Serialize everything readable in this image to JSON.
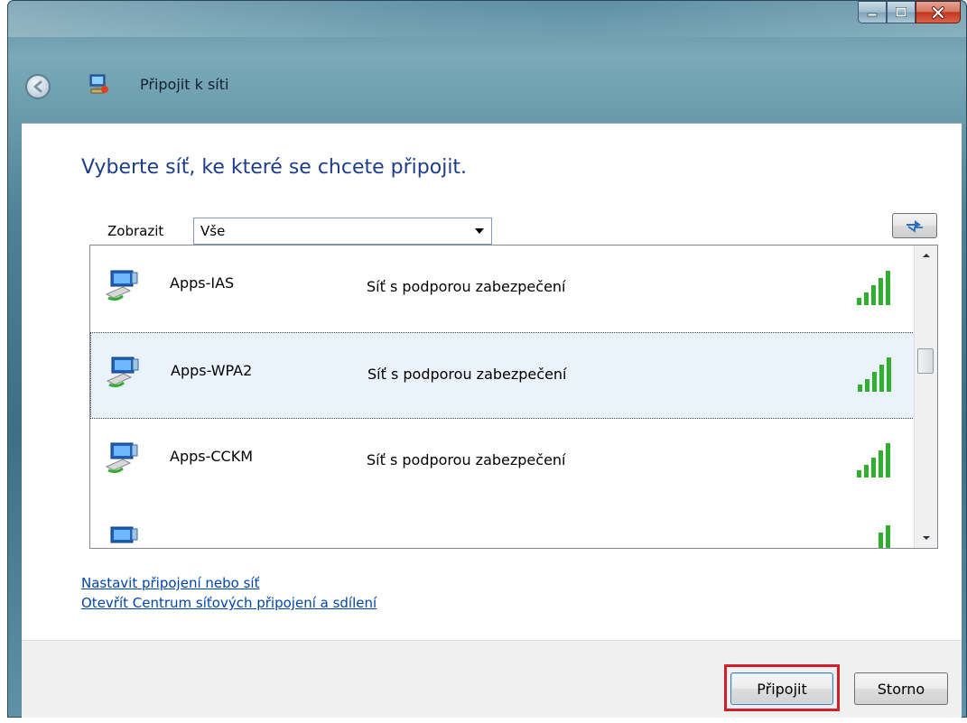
{
  "window": {
    "title": "Připojit k síti",
    "caption_buttons": [
      "minimize",
      "maximize",
      "close"
    ]
  },
  "main": {
    "heading": "Vyberte síť, ke které se chcete připojit.",
    "filter": {
      "label": "Zobrazit",
      "selected": "Vše"
    },
    "refresh_icon": "refresh-icon"
  },
  "networks": [
    {
      "name": "Apps-IAS",
      "security": "Síť s podporou zabezpečení",
      "signal_bars": 5,
      "selected": false
    },
    {
      "name": "Apps-WPA2",
      "security": "Síť s podporou zabezpečení",
      "signal_bars": 5,
      "selected": true
    },
    {
      "name": "Apps-CCKM",
      "security": "Síť s podporou zabezpečení",
      "signal_bars": 5,
      "selected": false
    }
  ],
  "links": {
    "setup": "Nastavit připojení nebo síť",
    "center": "Otevřít Centrum síťových připojení a sdílení"
  },
  "footer": {
    "connect_label": "Připojit",
    "cancel_label": "Storno"
  },
  "colors": {
    "heading": "#1d3d8a",
    "link": "#0044aa",
    "signal": "#2fae2f",
    "highlight": "#d0202a"
  }
}
